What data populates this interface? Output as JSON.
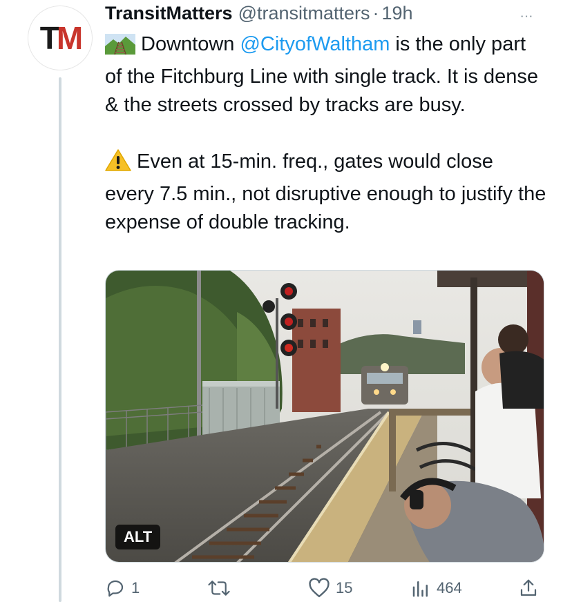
{
  "tweet": {
    "avatar_letters": "TM",
    "author_name": "TransitMatters",
    "author_handle": "@transitmatters",
    "separator": "·",
    "timestamp": "19h",
    "more_label": "···",
    "paragraph1_prefix": "Downtown ",
    "mention": "@CityofWaltham",
    "paragraph1_rest": " is the only part of the Fitchburg Line with single track. It is dense & the streets crossed by tracks are busy.",
    "paragraph2": "Even at 15-min. freq., gates would close every 7.5 min., not disruptive enough to justify the expense of double tracking.",
    "emoji1": "railway-track-icon",
    "emoji2": "warning-icon",
    "media": {
      "alt_label": "ALT",
      "description_icon": "train-platform-photo"
    },
    "actions": {
      "reply_count": "1",
      "retweet_count": "",
      "like_count": "15",
      "views_count": "464"
    },
    "colors": {
      "link": "#1d9bf0",
      "secondary_text": "#536471",
      "brand_red": "#c8352c"
    }
  }
}
